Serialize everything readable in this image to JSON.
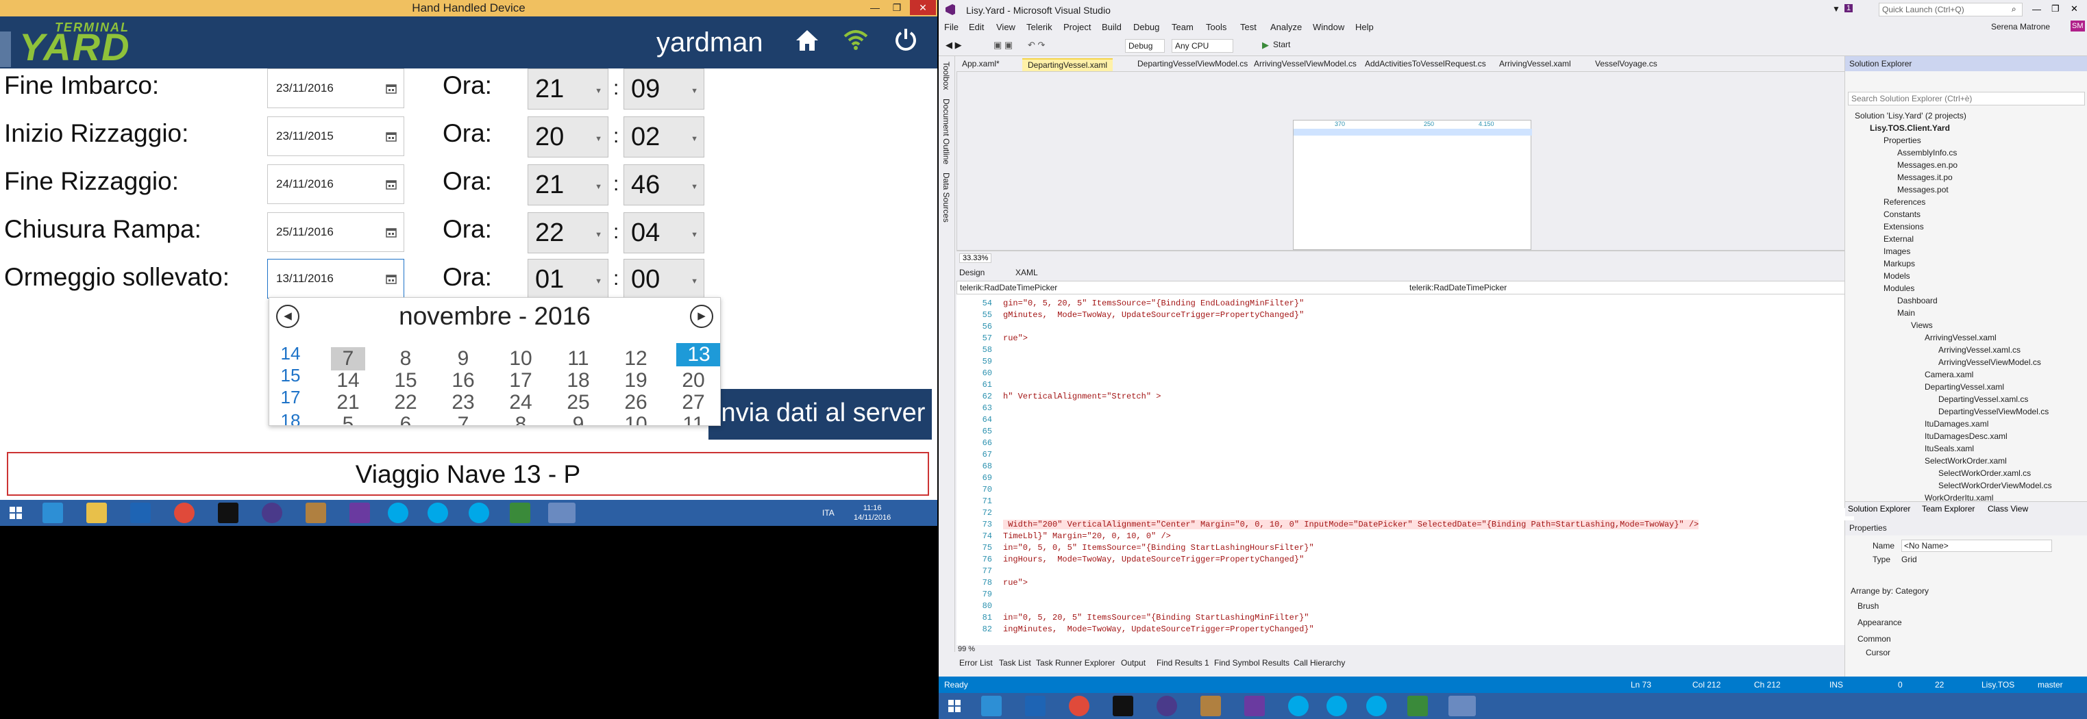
{
  "left": {
    "window_title": "Hand Handled Device",
    "logo_top": "TERMINAL",
    "logo_main": "YARD",
    "username": "yardman",
    "rows": [
      {
        "label": "Fine Imbarco:",
        "date": "23/11/2016",
        "ora_label": "Ora:",
        "hour": "21",
        "minute": "09"
      },
      {
        "label": "Inizio Rizzaggio:",
        "date": "23/11/2015",
        "ora_label": "Ora:",
        "hour": "20",
        "minute": "02"
      },
      {
        "label": "Fine Rizzaggio:",
        "date": "24/11/2016",
        "ora_label": "Ora:",
        "hour": "21",
        "minute": "46"
      },
      {
        "label": "Chiusura Rampa:",
        "date": "25/11/2016",
        "ora_label": "Ora:",
        "hour": "22",
        "minute": "04"
      },
      {
        "label": "Ormeggio sollevato:",
        "date": "13/11/2016",
        "ora_label": "Ora:",
        "hour": "01",
        "minute": "00"
      }
    ],
    "calendar": {
      "month_label": "novembre - 2016",
      "row1": [
        "14",
        "7",
        "8",
        "9",
        "10",
        "11",
        "12",
        "13"
      ],
      "row2": [
        "15",
        "14",
        "15",
        "16",
        "17",
        "18",
        "19",
        "20"
      ],
      "row3": [
        "17",
        "21",
        "22",
        "23",
        "24",
        "25",
        "26",
        "27"
      ],
      "row4": [
        "18",
        "5",
        "6",
        "7",
        "8",
        "9",
        "10",
        "11"
      ],
      "selected_day": "13"
    },
    "send_button": "Invia dati al server",
    "voyage": "Viaggio Nave 13 - P",
    "taskbar": {
      "lang": "ITA",
      "time": "11:16",
      "date": "14/11/2016"
    }
  },
  "vs": {
    "title": "Lisy.Yard - Microsoft Visual Studio",
    "quick_launch": "Quick Launch (Ctrl+Q)",
    "user": "Serena Matrone",
    "user_initials": "SM",
    "notif_count": "1",
    "menu": [
      "File",
      "Edit",
      "View",
      "Telerik",
      "Project",
      "Build",
      "Debug",
      "Team",
      "Tools",
      "Test",
      "Analyze",
      "Window",
      "Help"
    ],
    "config": "Debug",
    "platform": "Any CPU",
    "start": "Start",
    "side_tabs": [
      "Toolbox",
      "Document Outline",
      "Data Sources"
    ],
    "doc_tabs": [
      "App.xaml*",
      "DepartingVessel.xaml",
      "DepartingVesselViewModel.cs",
      "ArrivingVesselViewModel.cs",
      "AddActivitiesToVesselRequest.cs",
      "ArrivingVessel.xaml",
      "VesselVoyage.cs"
    ],
    "zoom": "33.33%",
    "design_tab": "Design",
    "xaml_tab": "XAML",
    "crumb_left": "telerik:RadDateTimePicker",
    "crumb_right": "telerik:RadDateTimePicker",
    "code_lines": [
      {
        "n": "54",
        "t": "gin=\"0, 5, 20, 5\" ItemsSource=\"{Binding EndLoadingMinFilter}\""
      },
      {
        "n": "55",
        "t": "gMinutes,  Mode=TwoWay, UpdateSourceTrigger=PropertyChanged}\""
      },
      {
        "n": "56",
        "t": ""
      },
      {
        "n": "57",
        "t": "rue\">"
      },
      {
        "n": "58",
        "t": ""
      },
      {
        "n": "59",
        "t": ""
      },
      {
        "n": "60",
        "t": ""
      },
      {
        "n": "61",
        "t": ""
      },
      {
        "n": "62",
        "t": "h\" VerticalAlignment=\"Stretch\" >"
      },
      {
        "n": "63",
        "t": ""
      },
      {
        "n": "64",
        "t": ""
      },
      {
        "n": "65",
        "t": ""
      },
      {
        "n": "66",
        "t": ""
      },
      {
        "n": "67",
        "t": ""
      },
      {
        "n": "68",
        "t": ""
      },
      {
        "n": "69",
        "t": ""
      },
      {
        "n": "70",
        "t": ""
      },
      {
        "n": "71",
        "t": ""
      },
      {
        "n": "72",
        "t": ""
      },
      {
        "n": "73",
        "t": " Width=\"200\" VerticalAlignment=\"Center\" Margin=\"0, 0, 10, 0\" InputMode=\"DatePicker\" SelectedDate=\"{Binding Path=StartLashing,Mode=TwoWay}\" />"
      },
      {
        "n": "74",
        "t": "TimeLbl}\" Margin=\"20, 0, 10, 0\" />"
      },
      {
        "n": "75",
        "t": "in=\"0, 5, 0, 5\" ItemsSource=\"{Binding StartLashingHoursFilter}\""
      },
      {
        "n": "76",
        "t": "ingHours,  Mode=TwoWay, UpdateSourceTrigger=PropertyChanged}\""
      },
      {
        "n": "77",
        "t": ""
      },
      {
        "n": "78",
        "t": "rue\">"
      },
      {
        "n": "79",
        "t": ""
      },
      {
        "n": "80",
        "t": ""
      },
      {
        "n": "81",
        "t": "in=\"0, 5, 20, 5\" ItemsSource=\"{Binding StartLashingMinFilter}\""
      },
      {
        "n": "82",
        "t": "ingMinutes,  Mode=TwoWay, UpdateSourceTrigger=PropertyChanged}\""
      }
    ],
    "code_zoom": "99 %",
    "bottom_tabs": [
      "Error List",
      "Task List",
      "Task Runner Explorer",
      "Output",
      "Find Results 1",
      "Find Symbol Results",
      "Call Hierarchy"
    ],
    "status": {
      "ready": "Ready",
      "ln": "Ln 73",
      "col": "Col 212",
      "ch": "Ch 212",
      "ins": "INS",
      "up": "0",
      "pencil": "22",
      "repo": "Lisy.TOS",
      "branch": "master"
    },
    "solution_explorer": {
      "title": "Solution Explorer",
      "search": "Search Solution Explorer (Ctrl+è)",
      "items": [
        "Solution 'Lisy.Yard' (2 projects)",
        "Lisy.TOS.Client.Yard",
        "Properties",
        "AssemblyInfo.cs",
        "Messages.en.po",
        "Messages.it.po",
        "Messages.pot",
        "References",
        "Constants",
        "Extensions",
        "External",
        "Images",
        "Markups",
        "Models",
        "Modules",
        "Dashboard",
        "Main",
        "Views",
        "ArrivingVessel.xaml",
        "ArrivingVessel.xaml.cs",
        "ArrivingVesselViewModel.cs",
        "Camera.xaml",
        "DepartingVessel.xaml",
        "DepartingVessel.xaml.cs",
        "DepartingVesselViewModel.cs",
        "ItuDamages.xaml",
        "ItuDamagesDesc.xaml",
        "ItuSeals.xaml",
        "SelectWorkOrder.xaml",
        "SelectWorkOrder.xaml.cs",
        "SelectWorkOrderViewModel.cs",
        "WorkOrderItu.xaml"
      ],
      "tabs": [
        "Solution Explorer",
        "Team Explorer",
        "Class View"
      ]
    },
    "properties": {
      "title": "Properties",
      "name_label": "Name",
      "name_value": "<No Name>",
      "type_label": "Type",
      "type_value": "Grid",
      "arrange": "Arrange by: Category",
      "cats": [
        "Brush",
        "Appearance",
        "Common",
        "Cursor"
      ]
    },
    "design_cols": [
      "370",
      "250",
      "4.150"
    ]
  },
  "colors": {
    "header_blue": "#1e3f6b",
    "logo_green": "#8fc23a",
    "vs_accent": "#007acc",
    "taskbar": "#2c5fa3"
  }
}
